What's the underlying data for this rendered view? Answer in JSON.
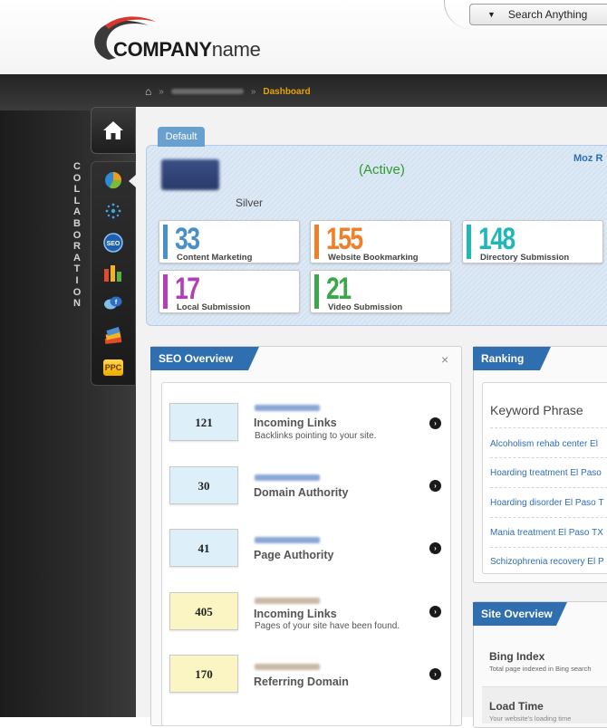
{
  "header": {
    "logo_bold": "COMPANY",
    "logo_light": "name",
    "search_label": "Search Anything"
  },
  "breadcrumb": {
    "current": "Dashboard"
  },
  "sidebar": {
    "word": "COLLABORATION",
    "items": [
      {
        "icon": "pie-chart-icon"
      },
      {
        "icon": "network-dots-icon"
      },
      {
        "icon": "seo-badge-icon"
      },
      {
        "icon": "bar-chart-icon"
      },
      {
        "icon": "chat-bubbles-icon"
      },
      {
        "icon": "stacked-books-icon"
      },
      {
        "icon": "ppc-icon",
        "label": "PPC"
      }
    ]
  },
  "overview": {
    "tab_label": "Default",
    "status": "(Active)",
    "plan": "Silver",
    "moz_label": "Moz R",
    "stats": [
      {
        "value": "33",
        "label": "Content Marketing",
        "color": "#4a90c8"
      },
      {
        "value": "155",
        "label": "Website Bookmarking",
        "color": "#f07f2a"
      },
      {
        "value": "148",
        "label": "Directory Submission",
        "color": "#1fb7b7"
      },
      {
        "value": "17",
        "label": "Local Submission",
        "color": "#b03fb8"
      },
      {
        "value": "21",
        "label": "Video Submission",
        "color": "#3aa84a"
      }
    ]
  },
  "seo_overview": {
    "title": "SEO Overview",
    "close": "×",
    "metrics": [
      {
        "value": "121",
        "title": "Incoming Links",
        "desc": "Backlinks pointing to your site."
      },
      {
        "value": "30",
        "title": "Domain Authority",
        "desc": ""
      },
      {
        "value": "41",
        "title": "Page Authority",
        "desc": ""
      },
      {
        "value": "405",
        "title": "Incoming Links",
        "desc": "Pages of your site have been found."
      },
      {
        "value": "170",
        "title": "Referring Domain",
        "desc": ""
      }
    ]
  },
  "ranking": {
    "title": "Ranking",
    "column": "Keyword Phrase",
    "keywords": [
      "Alcoholism rehab center El",
      "Hoarding treatment El Paso",
      "Hoarding disorder El Paso T",
      "Mania treatment El Paso TX",
      "Schizophrenia recovery El P"
    ]
  },
  "site_overview": {
    "title": "Site Overview",
    "bing_title": "Bing Index",
    "bing_desc": "Total page indexed in Bing search",
    "load_title": "Load Time",
    "load_desc": "Your website's loading time"
  }
}
